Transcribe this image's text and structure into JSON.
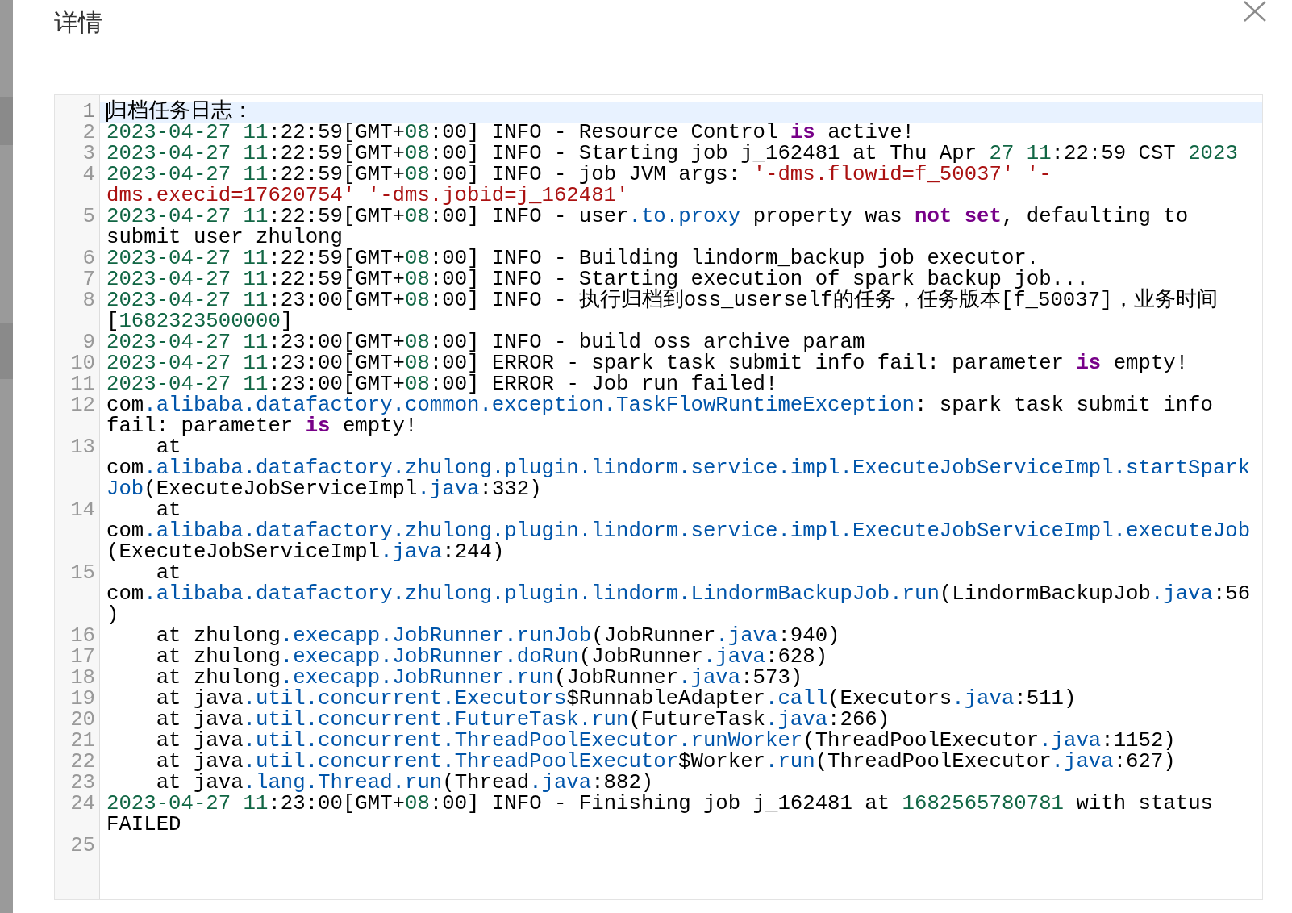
{
  "dialog": {
    "title": "详情"
  },
  "editor": {
    "lines": [
      {
        "number": "1",
        "active": true,
        "tokens": [
          {
            "kind": "plain",
            "text": "归档任务日志："
          }
        ]
      },
      {
        "number": "2",
        "active": false,
        "tokens": [
          {
            "kind": "number",
            "text": "2023-04-27 11"
          },
          {
            "kind": "plain",
            "text": ":22:59[GMT+"
          },
          {
            "kind": "number",
            "text": "08"
          },
          {
            "kind": "plain",
            "text": ":00] INFO - Resource Control "
          },
          {
            "kind": "keyword",
            "text": "is"
          },
          {
            "kind": "plain",
            "text": " active!"
          }
        ]
      },
      {
        "number": "3",
        "active": false,
        "tokens": [
          {
            "kind": "number",
            "text": "2023-04-27 11"
          },
          {
            "kind": "plain",
            "text": ":22:59[GMT+"
          },
          {
            "kind": "number",
            "text": "08"
          },
          {
            "kind": "plain",
            "text": ":00] INFO - Starting job j_162481 at Thu Apr "
          },
          {
            "kind": "number",
            "text": "27 11"
          },
          {
            "kind": "plain",
            "text": ":22:59 CST "
          },
          {
            "kind": "number",
            "text": "2023"
          }
        ]
      },
      {
        "number": "4",
        "active": false,
        "tokens": [
          {
            "kind": "number",
            "text": "2023-04-27 11"
          },
          {
            "kind": "plain",
            "text": ":22:59[GMT+"
          },
          {
            "kind": "number",
            "text": "08"
          },
          {
            "kind": "plain",
            "text": ":00] INFO - job JVM args: "
          },
          {
            "kind": "string",
            "text": "'-dms.flowid=f_50037' '-dms.execid=17620754' '-dms.jobid=j_162481'"
          }
        ]
      },
      {
        "number": "5",
        "active": false,
        "tokens": [
          {
            "kind": "number",
            "text": "2023-04-27 11"
          },
          {
            "kind": "plain",
            "text": ":22:59[GMT+"
          },
          {
            "kind": "number",
            "text": "08"
          },
          {
            "kind": "plain",
            "text": ":00] INFO - user"
          },
          {
            "kind": "property",
            "text": ".to.proxy"
          },
          {
            "kind": "plain",
            "text": " property was "
          },
          {
            "kind": "keyword",
            "text": "not set"
          },
          {
            "kind": "plain",
            "text": ", defaulting to submit user zhulong"
          }
        ]
      },
      {
        "number": "6",
        "active": false,
        "tokens": [
          {
            "kind": "number",
            "text": "2023-04-27 11"
          },
          {
            "kind": "plain",
            "text": ":22:59[GMT+"
          },
          {
            "kind": "number",
            "text": "08"
          },
          {
            "kind": "plain",
            "text": ":00] INFO - Building lindorm_backup job executor."
          }
        ]
      },
      {
        "number": "7",
        "active": false,
        "tokens": [
          {
            "kind": "number",
            "text": "2023-04-27 11"
          },
          {
            "kind": "plain",
            "text": ":22:59[GMT+"
          },
          {
            "kind": "number",
            "text": "08"
          },
          {
            "kind": "plain",
            "text": ":00] INFO - Starting execution of spark backup job..."
          }
        ]
      },
      {
        "number": "8",
        "active": false,
        "tokens": [
          {
            "kind": "number",
            "text": "2023-04-27 11"
          },
          {
            "kind": "plain",
            "text": ":23:00[GMT+"
          },
          {
            "kind": "number",
            "text": "08"
          },
          {
            "kind": "plain",
            "text": ":00] INFO - 执行归档到oss_userself的任务，任务版本[f_50037]，业务时间["
          },
          {
            "kind": "number",
            "text": "1682323500000"
          },
          {
            "kind": "plain",
            "text": "]"
          }
        ]
      },
      {
        "number": "9",
        "active": false,
        "tokens": [
          {
            "kind": "number",
            "text": "2023-04-27 11"
          },
          {
            "kind": "plain",
            "text": ":23:00[GMT+"
          },
          {
            "kind": "number",
            "text": "08"
          },
          {
            "kind": "plain",
            "text": ":00] INFO - build oss archive param"
          }
        ]
      },
      {
        "number": "10",
        "active": false,
        "tokens": [
          {
            "kind": "number",
            "text": "2023-04-27 11"
          },
          {
            "kind": "plain",
            "text": ":23:00[GMT+"
          },
          {
            "kind": "number",
            "text": "08"
          },
          {
            "kind": "plain",
            "text": ":00] ERROR - spark task submit info fail: parameter "
          },
          {
            "kind": "keyword",
            "text": "is"
          },
          {
            "kind": "plain",
            "text": " empty!"
          }
        ]
      },
      {
        "number": "11",
        "active": false,
        "tokens": [
          {
            "kind": "number",
            "text": "2023-04-27 11"
          },
          {
            "kind": "plain",
            "text": ":23:00[GMT+"
          },
          {
            "kind": "number",
            "text": "08"
          },
          {
            "kind": "plain",
            "text": ":00] ERROR - Job run failed!"
          }
        ]
      },
      {
        "number": "12",
        "active": false,
        "tokens": [
          {
            "kind": "plain",
            "text": "com"
          },
          {
            "kind": "property",
            "text": ".alibaba.datafactory.common.exception.TaskFlowRuntimeException"
          },
          {
            "kind": "plain",
            "text": ": spark task submit info fail: parameter "
          },
          {
            "kind": "keyword",
            "text": "is"
          },
          {
            "kind": "plain",
            "text": " empty!"
          }
        ]
      },
      {
        "number": "13",
        "active": false,
        "tokens": [
          {
            "kind": "plain",
            "text": "    at com"
          },
          {
            "kind": "property",
            "text": ".alibaba.datafactory.zhulong.plugin.lindorm.service.impl.ExecuteJobServiceImpl.startSparkJob"
          },
          {
            "kind": "plain",
            "text": "(ExecuteJobServiceImpl"
          },
          {
            "kind": "property",
            "text": ".java"
          },
          {
            "kind": "plain",
            "text": ":332)"
          }
        ]
      },
      {
        "number": "14",
        "active": false,
        "tokens": [
          {
            "kind": "plain",
            "text": "    at com"
          },
          {
            "kind": "property",
            "text": ".alibaba.datafactory.zhulong.plugin.lindorm.service.impl.ExecuteJobServiceImpl.executeJob"
          },
          {
            "kind": "plain",
            "text": "(ExecuteJobServiceImpl"
          },
          {
            "kind": "property",
            "text": ".java"
          },
          {
            "kind": "plain",
            "text": ":244)"
          }
        ]
      },
      {
        "number": "15",
        "active": false,
        "tokens": [
          {
            "kind": "plain",
            "text": "    at com"
          },
          {
            "kind": "property",
            "text": ".alibaba.datafactory.zhulong.plugin.lindorm.LindormBackupJob.run"
          },
          {
            "kind": "plain",
            "text": "(LindormBackupJob"
          },
          {
            "kind": "property",
            "text": ".java"
          },
          {
            "kind": "plain",
            "text": ":56)"
          }
        ]
      },
      {
        "number": "16",
        "active": false,
        "tokens": [
          {
            "kind": "plain",
            "text": "    at zhulong"
          },
          {
            "kind": "property",
            "text": ".execapp.JobRunner.runJob"
          },
          {
            "kind": "plain",
            "text": "(JobRunner"
          },
          {
            "kind": "property",
            "text": ".java"
          },
          {
            "kind": "plain",
            "text": ":940)"
          }
        ]
      },
      {
        "number": "17",
        "active": false,
        "tokens": [
          {
            "kind": "plain",
            "text": "    at zhulong"
          },
          {
            "kind": "property",
            "text": ".execapp.JobRunner.doRun"
          },
          {
            "kind": "plain",
            "text": "(JobRunner"
          },
          {
            "kind": "property",
            "text": ".java"
          },
          {
            "kind": "plain",
            "text": ":628)"
          }
        ]
      },
      {
        "number": "18",
        "active": false,
        "tokens": [
          {
            "kind": "plain",
            "text": "    at zhulong"
          },
          {
            "kind": "property",
            "text": ".execapp.JobRunner.run"
          },
          {
            "kind": "plain",
            "text": "(JobRunner"
          },
          {
            "kind": "property",
            "text": ".java"
          },
          {
            "kind": "plain",
            "text": ":573)"
          }
        ]
      },
      {
        "number": "19",
        "active": false,
        "tokens": [
          {
            "kind": "plain",
            "text": "    at java"
          },
          {
            "kind": "property",
            "text": ".util.concurrent.Executors"
          },
          {
            "kind": "plain",
            "text": "$RunnableAdapter"
          },
          {
            "kind": "property",
            "text": ".call"
          },
          {
            "kind": "plain",
            "text": "(Executors"
          },
          {
            "kind": "property",
            "text": ".java"
          },
          {
            "kind": "plain",
            "text": ":511)"
          }
        ]
      },
      {
        "number": "20",
        "active": false,
        "tokens": [
          {
            "kind": "plain",
            "text": "    at java"
          },
          {
            "kind": "property",
            "text": ".util.concurrent.FutureTask.run"
          },
          {
            "kind": "plain",
            "text": "(FutureTask"
          },
          {
            "kind": "property",
            "text": ".java"
          },
          {
            "kind": "plain",
            "text": ":266)"
          }
        ]
      },
      {
        "number": "21",
        "active": false,
        "tokens": [
          {
            "kind": "plain",
            "text": "    at java"
          },
          {
            "kind": "property",
            "text": ".util.concurrent.ThreadPoolExecutor.runWorker"
          },
          {
            "kind": "plain",
            "text": "(ThreadPoolExecutor"
          },
          {
            "kind": "property",
            "text": ".java"
          },
          {
            "kind": "plain",
            "text": ":1152)"
          }
        ]
      },
      {
        "number": "22",
        "active": false,
        "tokens": [
          {
            "kind": "plain",
            "text": "    at java"
          },
          {
            "kind": "property",
            "text": ".util.concurrent.ThreadPoolExecutor"
          },
          {
            "kind": "plain",
            "text": "$Worker"
          },
          {
            "kind": "property",
            "text": ".run"
          },
          {
            "kind": "plain",
            "text": "(ThreadPoolExecutor"
          },
          {
            "kind": "property",
            "text": ".java"
          },
          {
            "kind": "plain",
            "text": ":627)"
          }
        ]
      },
      {
        "number": "23",
        "active": false,
        "tokens": [
          {
            "kind": "plain",
            "text": "    at java"
          },
          {
            "kind": "property",
            "text": ".lang.Thread.run"
          },
          {
            "kind": "plain",
            "text": "(Thread"
          },
          {
            "kind": "property",
            "text": ".java"
          },
          {
            "kind": "plain",
            "text": ":882)"
          }
        ]
      },
      {
        "number": "24",
        "active": false,
        "tokens": [
          {
            "kind": "number",
            "text": "2023-04-27 11"
          },
          {
            "kind": "plain",
            "text": ":23:00[GMT+"
          },
          {
            "kind": "number",
            "text": "08"
          },
          {
            "kind": "plain",
            "text": ":00] INFO - Finishing job j_162481 at "
          },
          {
            "kind": "number",
            "text": "1682565780781"
          },
          {
            "kind": "plain",
            "text": " with status FAILED"
          }
        ]
      },
      {
        "number": "25",
        "active": false
      }
    ]
  }
}
